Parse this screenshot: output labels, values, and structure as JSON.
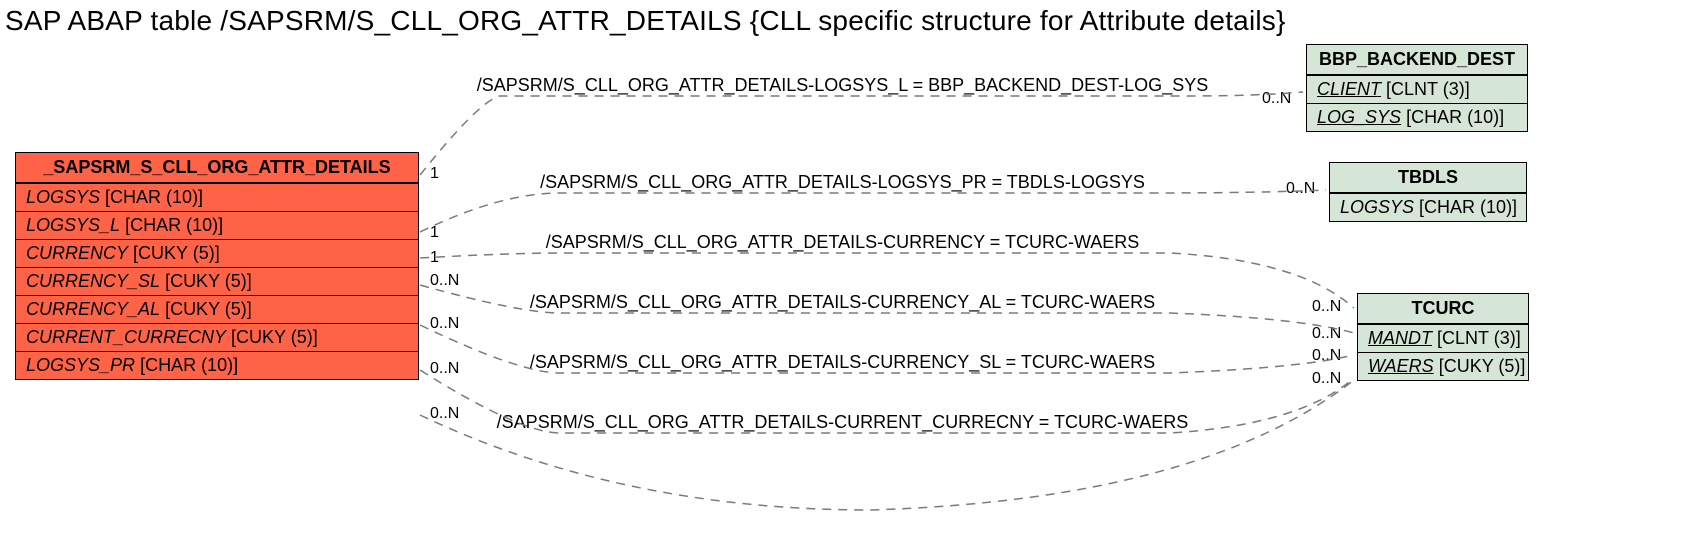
{
  "title": "SAP ABAP table /SAPSRM/S_CLL_ORG_ATTR_DETAILS {CLL specific structure for Attribute details}",
  "main_table": {
    "name": "_SAPSRM_S_CLL_ORG_ATTR_DETAILS",
    "fields": [
      {
        "name": "LOGSYS",
        "type": "[CHAR (10)]"
      },
      {
        "name": "LOGSYS_L",
        "type": "[CHAR (10)]"
      },
      {
        "name": "CURRENCY",
        "type": "[CUKY (5)]"
      },
      {
        "name": "CURRENCY_SL",
        "type": "[CUKY (5)]"
      },
      {
        "name": "CURRENCY_AL",
        "type": "[CUKY (5)]"
      },
      {
        "name": "CURRENT_CURRECNY",
        "type": "[CUKY (5)]"
      },
      {
        "name": "LOGSYS_PR",
        "type": "[CHAR (10)]"
      }
    ]
  },
  "ref_tables": {
    "bbp": {
      "name": "BBP_BACKEND_DEST",
      "fields": [
        {
          "name": "CLIENT",
          "type": "[CLNT (3)]"
        },
        {
          "name": "LOG_SYS",
          "type": "[CHAR (10)]"
        }
      ]
    },
    "tbdls": {
      "name": "TBDLS",
      "fields": [
        {
          "name": "LOGSYS",
          "type": "[CHAR (10)]"
        }
      ]
    },
    "tcurc": {
      "name": "TCURC",
      "fields": [
        {
          "name": "MANDT",
          "type": "[CLNT (3)]"
        },
        {
          "name": "WAERS",
          "type": "[CUKY (5)]"
        }
      ]
    }
  },
  "relations": {
    "r1": {
      "label": "/SAPSRM/S_CLL_ORG_ATTR_DETAILS-LOGSYS_L = BBP_BACKEND_DEST-LOG_SYS",
      "left": "1",
      "right": "0..N"
    },
    "r2": {
      "label": "/SAPSRM/S_CLL_ORG_ATTR_DETAILS-LOGSYS_PR = TBDLS-LOGSYS",
      "left": "1",
      "right": "0..N"
    },
    "r3": {
      "label": "/SAPSRM/S_CLL_ORG_ATTR_DETAILS-CURRENCY = TCURC-WAERS",
      "left": "1",
      "right": ""
    },
    "r4": {
      "label": "/SAPSRM/S_CLL_ORG_ATTR_DETAILS-CURRENCY_AL = TCURC-WAERS",
      "left": "0..N",
      "right": "0..N"
    },
    "r5": {
      "label": "/SAPSRM/S_CLL_ORG_ATTR_DETAILS-CURRENCY_SL = TCURC-WAERS",
      "left": "0..N",
      "right": "0..N"
    },
    "r6": {
      "label": "/SAPSRM/S_CLL_ORG_ATTR_DETAILS-CURRENT_CURRECNY = TCURC-WAERS",
      "left": "0..N",
      "right": "0..N"
    },
    "extra_right_top": "0..N"
  }
}
